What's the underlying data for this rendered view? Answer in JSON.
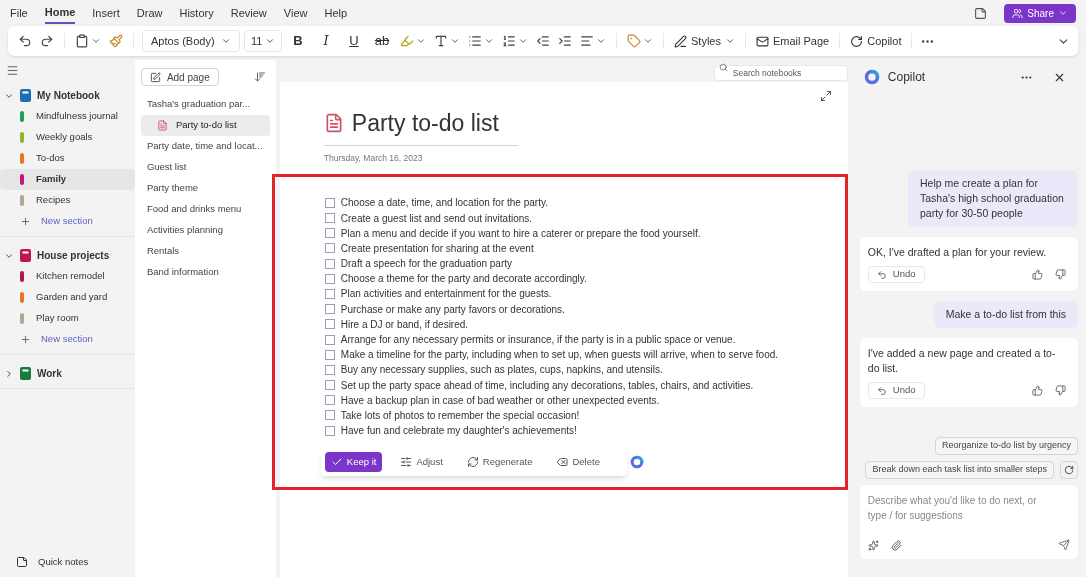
{
  "menu": [
    {
      "label": "File",
      "selected": false
    },
    {
      "label": "Home",
      "selected": true
    },
    {
      "label": "Insert",
      "selected": false
    },
    {
      "label": "Draw",
      "selected": false
    },
    {
      "label": "History",
      "selected": false
    },
    {
      "label": "Review",
      "selected": false
    },
    {
      "label": "View",
      "selected": false
    },
    {
      "label": "Help",
      "selected": false
    }
  ],
  "share": "Share",
  "toolbar": {
    "font": "Aptos (Body)",
    "size": "11",
    "format_buttons": [
      {
        "label": "B",
        "kind": "bold"
      },
      {
        "label": "I",
        "kind": "italic"
      },
      {
        "label": "U",
        "kind": "underline"
      },
      {
        "label": "ab",
        "kind": "strike"
      }
    ],
    "styles": "Styles",
    "email": "Email Page",
    "copilot": "Copilot"
  },
  "search": {
    "placeholder": "Search notebooks"
  },
  "notebooks": [
    {
      "name": "My Notebook",
      "color": "#1f6fb5",
      "expanded": true,
      "sections": [
        {
          "name": "Mindfulness journal",
          "color": "#1f9d5b",
          "selected": false
        },
        {
          "name": "Weekly goals",
          "color": "#8db92b",
          "selected": false
        },
        {
          "name": "To-dos",
          "color": "#e8742a",
          "selected": false
        },
        {
          "name": "Family",
          "color": "#c2187a",
          "selected": true
        },
        {
          "name": "Recipes",
          "color": "#b5a690",
          "selected": false
        }
      ],
      "new_section": "New section"
    },
    {
      "name": "House projects",
      "color": "#c0174a",
      "expanded": true,
      "sections": [
        {
          "name": "Kitchen remodel",
          "color": "#b5174a",
          "selected": false
        },
        {
          "name": "Garden and yard",
          "color": "#e8742a",
          "selected": false
        },
        {
          "name": "Play room",
          "color": "#b5a690",
          "selected": false
        }
      ],
      "new_section": "New section"
    },
    {
      "name": "Work",
      "color": "#1c7a3e",
      "expanded": false
    }
  ],
  "quick_notes": "Quick notes",
  "pages": {
    "add_page": "Add page",
    "items": [
      {
        "title": "Tasha's graduation par...",
        "selected": false
      },
      {
        "title": "Party to-do list",
        "selected": true
      },
      {
        "title": "Party date, time and locat...",
        "selected": false
      },
      {
        "title": "Guest list",
        "selected": false
      },
      {
        "title": "Party theme",
        "selected": false
      },
      {
        "title": "Food and drinks menu",
        "selected": false
      },
      {
        "title": "Activities planning",
        "selected": false
      },
      {
        "title": "Rentals",
        "selected": false
      },
      {
        "title": "Band information",
        "selected": false
      }
    ]
  },
  "page": {
    "title": "Party to-do list",
    "date": "Thursday, March 16, 2023",
    "tasks": [
      {
        "text": "Choose a date, time, and location for the party.",
        "checked": false
      },
      {
        "text": "Create a guest list and send out invitations.",
        "checked": false
      },
      {
        "text": "Plan a menu and decide if you want to hire a caterer or prepare the food yourself.",
        "checked": false
      },
      {
        "text": "Create presentation for sharing at the event",
        "checked": false
      },
      {
        "text": "Draft a speech for the graduation party",
        "checked": false
      },
      {
        "text": "Choose a theme for the party and decorate accordingly.",
        "checked": false
      },
      {
        "text": "Plan activities and entertainment for the guests.",
        "checked": false
      },
      {
        "text": "Purchase or make any party favors or decorations.",
        "checked": false
      },
      {
        "text": "Hire a DJ or band, if desired.",
        "checked": false
      },
      {
        "text": "Arrange for any necessary permits or insurance, if the party is in a public space or venue.",
        "checked": false
      },
      {
        "text": "Make a timeline for the party, including when to set up, when guests will arrive, when to serve food.",
        "checked": false
      },
      {
        "text": "Buy any necessary supplies, such as plates, cups, napkins, and utensils.",
        "checked": false
      },
      {
        "text": "Set up the party space ahead of time, including any decorations, tables, chairs, and activities.",
        "checked": false
      },
      {
        "text": "Have a backup plan in case of bad weather or other unexpected events.",
        "checked": false
      },
      {
        "text": "Take lots of photos to remember the special occasion!",
        "checked": false
      },
      {
        "text": "Have fun and celebrate my daughter's achievements!",
        "checked": false
      }
    ],
    "actions": [
      {
        "label": "Keep it",
        "kind": "keep"
      },
      {
        "label": "Adjust",
        "kind": "adjust"
      },
      {
        "label": "Regenerate",
        "kind": "regenerate"
      },
      {
        "label": "Delete",
        "kind": "delete"
      }
    ]
  },
  "copilot": {
    "title": "Copilot",
    "messages": [
      {
        "kind": "user",
        "text": "Help me create a plan for Tasha's high school graduation party for 30-50 people"
      },
      {
        "kind": "assistant",
        "text": "OK, I've drafted a plan for your review.",
        "undo": "Undo"
      },
      {
        "kind": "user",
        "text": "Make a to-do list from this"
      },
      {
        "kind": "assistant",
        "text": "I've added a new page and created a to-do list.",
        "undo": "Undo"
      }
    ],
    "suggestions": [
      "Reorganize to-do list by urgency",
      "Break down each task list into smaller steps"
    ],
    "input": {
      "placeholder": "Describe what you'd like to do next, or type / for suggestions"
    }
  }
}
